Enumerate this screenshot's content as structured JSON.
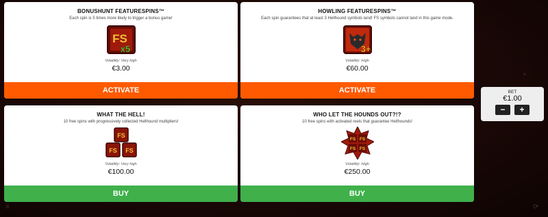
{
  "cards": [
    {
      "title": "BONUSHUNT FEATURESPINS™",
      "description": "Each spin is 5 times more likely to trigger a bonus game!",
      "symbol_icon": "fs-x5-symbol-icon",
      "symbol_text": "FS",
      "symbol_badge": "x5",
      "volatility": "Volatility: Very high",
      "price": "€3.00",
      "action": "ACTIVATE",
      "action_color": "#ff5a00"
    },
    {
      "title": "HOWLING FEATURESPINS™",
      "description": "Each spin guarantees that at least 3 Hellhound symbols land! FS symbols cannot land in this game mode.",
      "symbol_icon": "hellhound-3plus-symbol-icon",
      "symbol_badge": "3+",
      "volatility": "Volatility: High",
      "price": "€60.00",
      "action": "ACTIVATE",
      "action_color": "#ff5a00"
    },
    {
      "title": "WHAT THE HELL!",
      "description": "10 free spins with progressively collected Hellhound multipliers!",
      "symbol_icon": "three-fs-symbols-icon",
      "symbol_text": "FS",
      "volatility": "Volatility: Very high",
      "price": "€100.00",
      "action": "BUY",
      "action_color": "#3fb04a"
    },
    {
      "title": "WHO LET THE HOUNDS OUT?!?",
      "description": "10 free spins with activated reels that guarantee Hellhounds!",
      "symbol_icon": "four-fs-star-symbol-icon",
      "symbol_text": "FS",
      "volatility": "Volatility: High",
      "price": "€250.00",
      "action": "BUY",
      "action_color": "#3fb04a"
    }
  ],
  "bet": {
    "label": "BET",
    "value": "€1.00",
    "minus": "−",
    "plus": "+"
  }
}
